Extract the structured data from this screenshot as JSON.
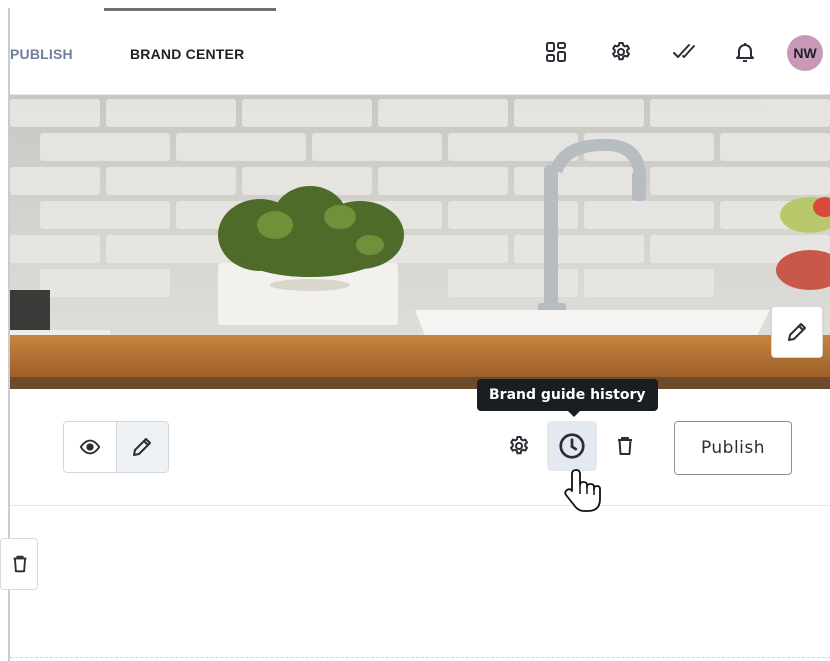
{
  "nav": {
    "tabs": [
      {
        "label": "PUBLISH",
        "active": false
      },
      {
        "label": "BRAND CENTER",
        "active": true
      }
    ],
    "icons": [
      "grid-icon",
      "settings-gear-icon",
      "double-check-icon",
      "bell-icon"
    ],
    "avatar_initials": "NW",
    "avatar_color": "#c998b8"
  },
  "hero": {
    "image_subject": "kitchen counter with white brick wall, potted plant, faucet and sink",
    "edit_icon": "pencil-icon"
  },
  "toolbar": {
    "view_toggle": [
      "eye-icon",
      "pencil-icon"
    ],
    "active_mode": "edit",
    "actions": [
      "settings-gear-icon",
      "history-clock-icon",
      "trash-icon"
    ],
    "publish_label": "Publish"
  },
  "tooltip": {
    "text": "Brand guide history"
  },
  "lower": {
    "delete_icon": "trash-icon"
  },
  "colors": {
    "nav_active": "#1d2227",
    "nav_inactive": "#6e7f9a",
    "tooltip_bg": "#1a1d21",
    "hover_bg": "#e3e9ef"
  }
}
